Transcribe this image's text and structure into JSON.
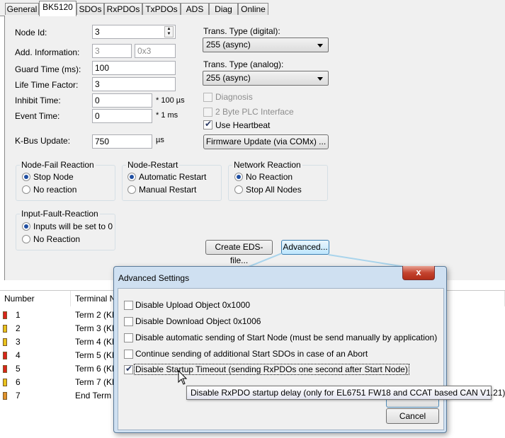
{
  "tabs": [
    "General",
    "BK5120",
    "SDOs",
    "RxPDOs",
    "TxPDOs",
    "ADS",
    "Diag",
    "Online"
  ],
  "active_tab": "BK5120",
  "fields": {
    "node_id": {
      "label": "Node Id:",
      "value": "3"
    },
    "add_info": {
      "label": "Add. Information:",
      "value1": "3",
      "value2": "0x3"
    },
    "guard_time": {
      "label": "Guard Time (ms):",
      "value": "100"
    },
    "life_time": {
      "label": "Life Time Factor:",
      "value": "3"
    },
    "inhibit_time": {
      "label": "Inhibit Time:",
      "value": "0",
      "unit": "* 100 µs"
    },
    "event_time": {
      "label": "Event Time:",
      "value": "0",
      "unit": "* 1 ms"
    },
    "kbus_update": {
      "label": "K-Bus Update:",
      "value": "750",
      "unit": "µs"
    }
  },
  "trans_digital": {
    "label": "Trans. Type (digital):",
    "value": "255 (async)"
  },
  "trans_analog": {
    "label": "Trans. Type (analog):",
    "value": "255 (async)"
  },
  "checks": {
    "diagnosis": "Diagnosis",
    "plc_interface": "2 Byte PLC Interface",
    "heartbeat": "Use Heartbeat"
  },
  "firmware_button": "Firmware Update (via COMx) ...",
  "groups": {
    "node_fail": {
      "title": "Node-Fail Reaction",
      "opt1": "Stop Node",
      "opt2": "No reaction"
    },
    "node_restart": {
      "title": "Node-Restart",
      "opt1": "Automatic Restart",
      "opt2": "Manual Restart"
    },
    "network": {
      "title": "Network Reaction",
      "opt1": "No Reaction",
      "opt2": "Stop All Nodes"
    },
    "input_fault": {
      "title": "Input-Fault-Reaction",
      "opt1": "Inputs will be set to 0",
      "opt2": "No Reaction"
    }
  },
  "buttons": {
    "create_eds": "Create EDS-file...",
    "advanced": "Advanced..."
  },
  "list": {
    "headers": [
      "Number",
      "Terminal N"
    ],
    "rows": [
      {
        "number": "1",
        "terminal": "Term 2 (KL",
        "color": "#d8241b"
      },
      {
        "number": "2",
        "terminal": "Term 3 (KL",
        "color": "#e8c21c"
      },
      {
        "number": "3",
        "terminal": "Term 4 (KL",
        "color": "#e8c21c"
      },
      {
        "number": "4",
        "terminal": "Term 5 (KL",
        "color": "#d8241b"
      },
      {
        "number": "5",
        "terminal": "Term 6 (KL",
        "color": "#d8241b"
      },
      {
        "number": "6",
        "terminal": "Term 7 (KL",
        "color": "#e8c21c"
      },
      {
        "number": "7",
        "terminal": "End Term",
        "color": "#e0912a"
      }
    ]
  },
  "dialog": {
    "title": "Advanced Settings",
    "close": "x",
    "options": [
      "Disable Upload Object 0x1000",
      "Disable Download Object 0x1006",
      "Disable automatic sending of Start Node (must be send manually by application)",
      "Continue sending of additional Start SDOs in case of an Abort",
      "Disable Startup Timeout (sending RxPDOs one second after Start Node)"
    ],
    "cancel": "Cancel",
    "tooltip": "Disable RxPDO startup delay (only for EL6751 FW18 and CCAT based CAN V1.21)"
  }
}
